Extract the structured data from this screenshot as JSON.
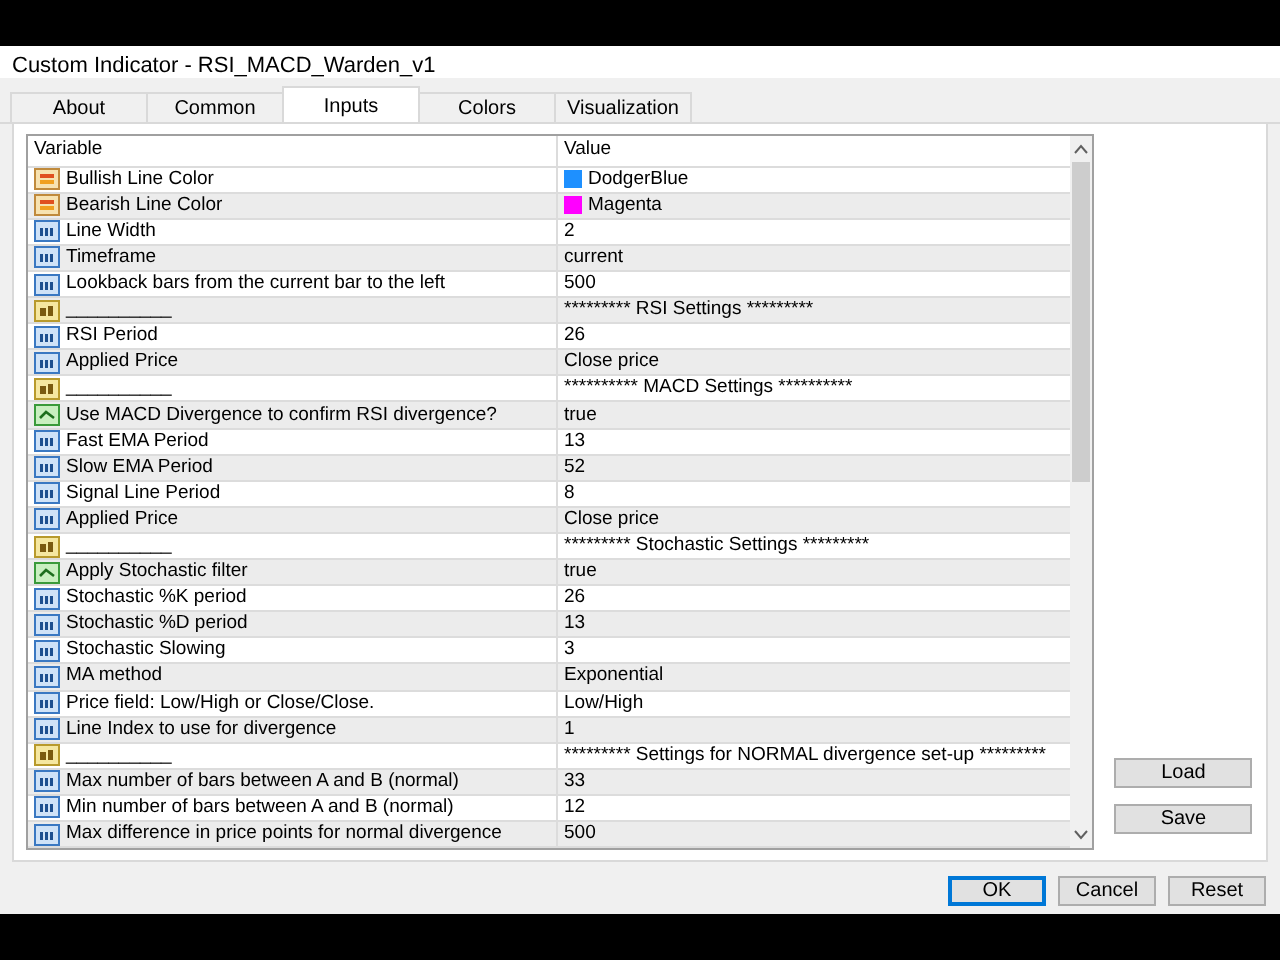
{
  "window": {
    "title": "Custom Indicator - RSI_MACD_Warden_v1"
  },
  "tabs": [
    {
      "label": "About",
      "selected": false
    },
    {
      "label": "Common",
      "selected": false
    },
    {
      "label": "Inputs",
      "selected": true
    },
    {
      "label": "Colors",
      "selected": false
    },
    {
      "label": "Visualization",
      "selected": false
    }
  ],
  "table": {
    "columns": [
      "Variable",
      "Value"
    ],
    "rows": [
      {
        "kind": "color",
        "variable": "Bullish Line Color",
        "value": "DodgerBlue",
        "color": "#1e90ff"
      },
      {
        "kind": "color",
        "variable": "Bearish Line Color",
        "value": "Magenta",
        "color": "#ff00ff"
      },
      {
        "kind": "number",
        "variable": "Line Width",
        "value": "2"
      },
      {
        "kind": "number",
        "variable": "Timeframe",
        "value": "current"
      },
      {
        "kind": "number",
        "variable": "Lookback bars from the current bar to the left",
        "value": "500"
      },
      {
        "kind": "text",
        "variable": "__________",
        "value": "********* RSI Settings *********"
      },
      {
        "kind": "number",
        "variable": "RSI Period",
        "value": "26"
      },
      {
        "kind": "number",
        "variable": "Applied Price",
        "value": "Close price"
      },
      {
        "kind": "text",
        "variable": "__________",
        "value": "********** MACD Settings **********"
      },
      {
        "kind": "bool",
        "variable": "Use MACD Divergence to confirm RSI divergence?",
        "value": "true"
      },
      {
        "kind": "number",
        "variable": "Fast EMA Period",
        "value": "13"
      },
      {
        "kind": "number",
        "variable": "Slow EMA Period",
        "value": "52"
      },
      {
        "kind": "number",
        "variable": "Signal Line Period",
        "value": "8"
      },
      {
        "kind": "number",
        "variable": "Applied Price",
        "value": "Close price"
      },
      {
        "kind": "text",
        "variable": "__________",
        "value": "********* Stochastic Settings *********"
      },
      {
        "kind": "bool",
        "variable": "Apply Stochastic filter",
        "value": "true"
      },
      {
        "kind": "number",
        "variable": "Stochastic %K period",
        "value": "26"
      },
      {
        "kind": "number",
        "variable": "Stochastic %D period",
        "value": "13"
      },
      {
        "kind": "number",
        "variable": "Stochastic Slowing",
        "value": "3"
      },
      {
        "kind": "number",
        "variable": "MA method",
        "value": "Exponential"
      },
      {
        "kind": "number",
        "variable": "Price field: Low/High or Close/Close.",
        "value": "Low/High"
      },
      {
        "kind": "number",
        "variable": "Line Index to use for divergence",
        "value": "1"
      },
      {
        "kind": "text",
        "variable": "__________",
        "value": "********* Settings for NORMAL divergence set-up *********"
      },
      {
        "kind": "number",
        "variable": "Max number of bars between A and B (normal)",
        "value": "33"
      },
      {
        "kind": "number",
        "variable": "Min number of bars between A and B (normal)",
        "value": "12"
      },
      {
        "kind": "number",
        "variable": "Max difference in price points for normal divergence",
        "value": "500"
      }
    ]
  },
  "side_buttons": [
    "Load",
    "Save"
  ],
  "buttons": [
    {
      "label": "OK",
      "default": true
    },
    {
      "label": "Cancel",
      "default": false
    },
    {
      "label": "Reset",
      "default": false
    }
  ]
}
